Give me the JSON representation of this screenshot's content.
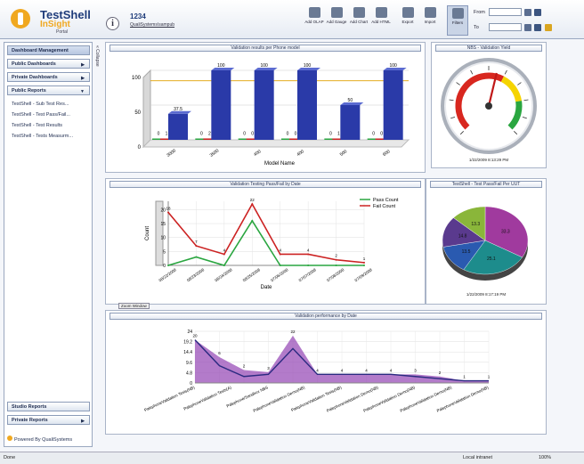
{
  "header": {
    "brand_top": "TestShell",
    "brand_mid": "InSight",
    "brand_sub": "Portal",
    "account_id": "1234",
    "account_user": "QualiSystems\\sampub",
    "toolbar": [
      {
        "label": "Add OLAP",
        "icon": "olap-icon"
      },
      {
        "label": "Add Gauge",
        "icon": "gauge-icon"
      },
      {
        "label": "Add Chart",
        "icon": "chart-icon"
      },
      {
        "label": "Add HTML",
        "icon": "html-icon"
      },
      {
        "label": "Export",
        "icon": "export-icon"
      },
      {
        "label": "Import",
        "icon": "import-icon"
      },
      {
        "label": "Filters",
        "icon": "filter-icon"
      }
    ],
    "from_label": "From",
    "to_label": "To"
  },
  "sidebar": {
    "dashboard_management": "Dashboard Management",
    "public_dashboards": "Public Dashboards",
    "private_dashboards": "Private Dashboards",
    "public_reports": "Public Reports",
    "reports": [
      "TestShell - Sub Test Res...",
      "TestShell - Test Pass/Fail...",
      "TestShell - Test Results",
      "TestShell - Tests Measurm..."
    ],
    "studio_reports": "Studio Reports",
    "private_reports": "Private Reports",
    "powered_by": "Powered By QualiSystems",
    "collapse_label": "« Collapse"
  },
  "panels": {
    "p1_title": "Validation results per Phone model",
    "p2_title": "NBS - Validation Yield",
    "p2_date": "1/22/2009 8:13:29 PM",
    "p3_title": "Validation Testing Pass/Fail by Date",
    "p3_tooltip": "Zoom Window",
    "p4_title": "TestShell - Test Pass/Fail Per UUT",
    "p4_date": "1/22/2009 8:17:19 PM",
    "p5_title": "Validation performance by Date"
  },
  "chart_data": [
    {
      "type": "bar",
      "title": "Validation results per Phone model",
      "xlabel": "Model Name",
      "categories": [
        "3000",
        "3500",
        "400",
        "400",
        "500",
        "600"
      ],
      "series": [
        {
          "name": "",
          "color": "#2aa640",
          "values": [
            0,
            0,
            0,
            0,
            0,
            0
          ]
        },
        {
          "name": "",
          "color": "#cc2222",
          "values": [
            1,
            2,
            0,
            0,
            1,
            0
          ]
        },
        {
          "name": "",
          "color": "#2a3aa8",
          "values": [
            37.5,
            100,
            100,
            100,
            50,
            100
          ]
        }
      ],
      "bar_labels": [
        [
          "0",
          "1",
          "37.5"
        ],
        [
          "0",
          "2",
          "100"
        ],
        [
          "0",
          "0",
          "100"
        ],
        [
          "0",
          "0",
          "100"
        ],
        [
          "0",
          "1",
          "50"
        ],
        [
          "0",
          "0",
          "100"
        ]
      ],
      "ylim": [
        0,
        100
      ],
      "yticks": [
        0,
        50,
        100
      ],
      "target_line": 85
    },
    {
      "type": "gauge",
      "value": 55,
      "range": [
        0,
        100
      ],
      "bands": [
        {
          "from": 0,
          "to": 60,
          "color": "#d8271f"
        },
        {
          "from": 60,
          "to": 80,
          "color": "#f5d400"
        },
        {
          "from": 80,
          "to": 100,
          "color": "#2aa640"
        }
      ]
    },
    {
      "type": "line",
      "title": "Validation Testing Pass/Fail by Date",
      "xlabel": "Date",
      "ylabel": "Count",
      "x": [
        "08/22/2008",
        "08/23/2008",
        "08/24/2008",
        "08/25/2008",
        "07/06/2008",
        "07/07/2008",
        "07/08/2008",
        "07/09/2008"
      ],
      "series": [
        {
          "name": "Pass Count",
          "color": "#2aa640",
          "values": [
            0,
            3,
            0,
            16,
            0,
            0,
            0,
            0
          ]
        },
        {
          "name": "Fail Count",
          "color": "#cc2222",
          "values": [
            19,
            7,
            4,
            22,
            4,
            4,
            2,
            1
          ]
        }
      ],
      "ylim": [
        0,
        23
      ],
      "yticks": [
        0,
        5,
        10,
        15,
        20
      ],
      "point_labels": [
        "18",
        "7",
        "4",
        "22",
        "4",
        "4",
        "2",
        "1"
      ]
    },
    {
      "type": "pie",
      "title": "TestShell - Test Pass/Fail Per UUT",
      "slices": [
        {
          "label": "33.3",
          "value": 33.3,
          "color": "#a03a9e"
        },
        {
          "label": "25.1",
          "value": 25.1,
          "color": "#1d8c8c"
        },
        {
          "label": "13.5",
          "value": 13.5,
          "color": "#2a5ab0"
        },
        {
          "label": "14.8",
          "value": 14.8,
          "color": "#5a3a8e"
        },
        {
          "label": "13.3",
          "value": 13.3,
          "color": "#8ab63a"
        }
      ]
    },
    {
      "type": "area",
      "title": "Validation performance by Date",
      "ylim": [
        0,
        24
      ],
      "yticks": [
        0,
        4.8,
        9.6,
        14.4,
        19.2,
        24
      ],
      "categories": [
        "PalephoneValidation Tests(NB)",
        "PalephoneValidation Tests(A)",
        "Palephone/Sandbox NBS",
        "PalephoneValidation Demo(NB)",
        "PalephoneValidation Tests(NB)",
        "PalephoneValidation Demo(NB)",
        "PalephoneValidation Demo(NB)",
        "PalephoneValidation Demo(NB)",
        "PalephoneValidation Demo(NB)"
      ],
      "x_positions": [
        0,
        0.75,
        1.5,
        2.25,
        3,
        3.75,
        4.5,
        5.25,
        6,
        6.75,
        7.5,
        8.25,
        9
      ],
      "series": [
        {
          "name": "",
          "color": "#9a4fb8",
          "values": [
            20,
            12,
            6,
            5,
            22,
            4,
            4,
            4,
            4,
            4,
            3,
            1,
            1
          ]
        },
        {
          "name": "",
          "color": "#2a2a80",
          "values": [
            20,
            8,
            3,
            4,
            16,
            4,
            4,
            4,
            4,
            3,
            2,
            1,
            1
          ]
        }
      ],
      "point_labels": [
        "20",
        "6",
        "2",
        "3",
        "22",
        "4",
        "4",
        "4",
        "4",
        "3",
        "2",
        "1",
        "1"
      ]
    }
  ],
  "status": {
    "left": "Done",
    "zone": "Local intranet",
    "zoom": "100%"
  }
}
